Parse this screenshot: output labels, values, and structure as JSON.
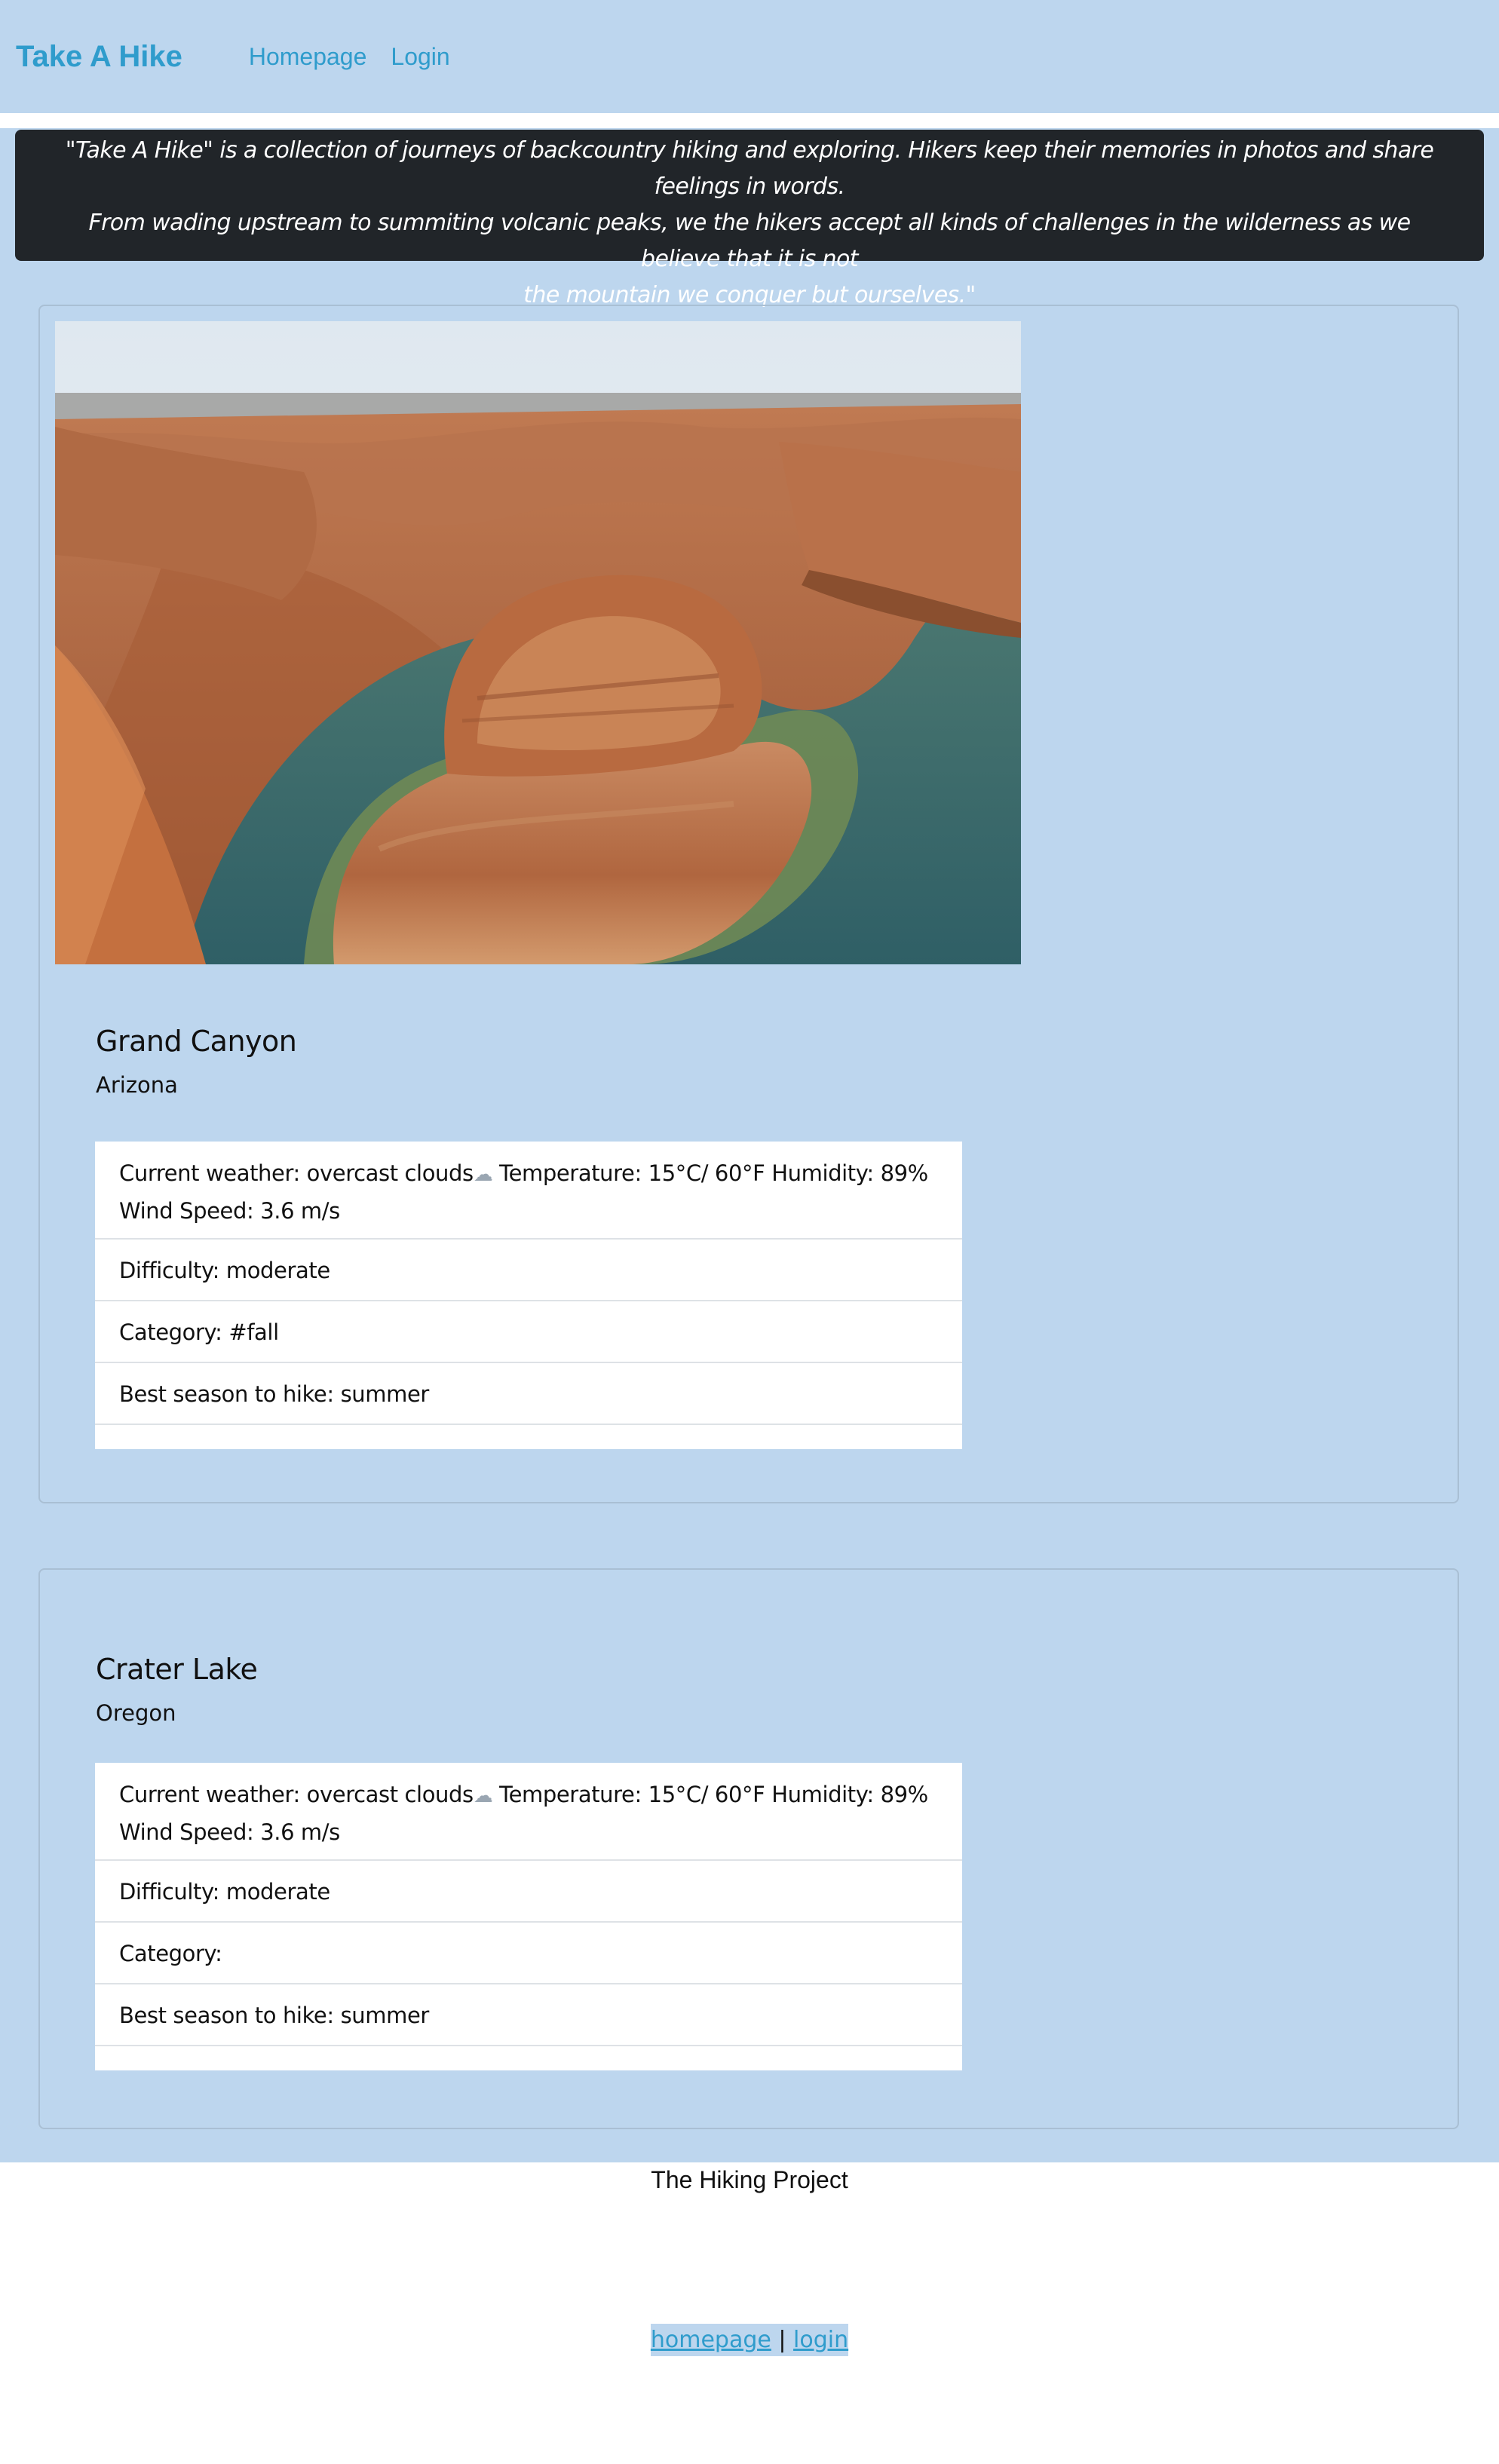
{
  "navbar": {
    "brand": "Take A Hike",
    "links": [
      "Homepage",
      "Login"
    ]
  },
  "intro": {
    "lines": [
      "\"Take A Hike\" is a collection of journeys of backcountry hiking and exploring. Hikers keep their memories in photos and share feelings in words.",
      "From wading upstream to summiting volcanic peaks, we the hikers accept all kinds of challenges in the wilderness as we believe that it is not",
      "the mountain we conquer but ourselves.\""
    ]
  },
  "hikes": [
    {
      "title": "Grand Canyon",
      "state": "Arizona",
      "photo_icon": "canyon-photo",
      "weather_prefix": "Current weather: overcast clouds",
      "weather_suffix": " Temperature: 15°C/ 60°F Humidity: 89% Wind Speed: 3.6 m/s",
      "weather_icon": "cloud-icon",
      "difficulty": "Difficulty: moderate",
      "category": "Category: #fall",
      "season": "Best season to hike: summer"
    },
    {
      "title": "Crater Lake",
      "state": "Oregon",
      "weather_prefix": "Current weather: overcast clouds",
      "weather_suffix": " Temperature: 15°C/ 60°F Humidity: 89% Wind Speed: 3.6 m/s",
      "weather_icon": "cloud-icon",
      "difficulty": "Difficulty: moderate",
      "category": "Category:",
      "season": "Best season to hike: summer"
    }
  ],
  "footer": {
    "title": "The Hiking Project",
    "links": [
      "homepage",
      "login"
    ],
    "separator": "|"
  },
  "colors": {
    "page_bg": "#bdd6ee",
    "accent": "#2f9ccc",
    "quote_bg": "#212529"
  }
}
